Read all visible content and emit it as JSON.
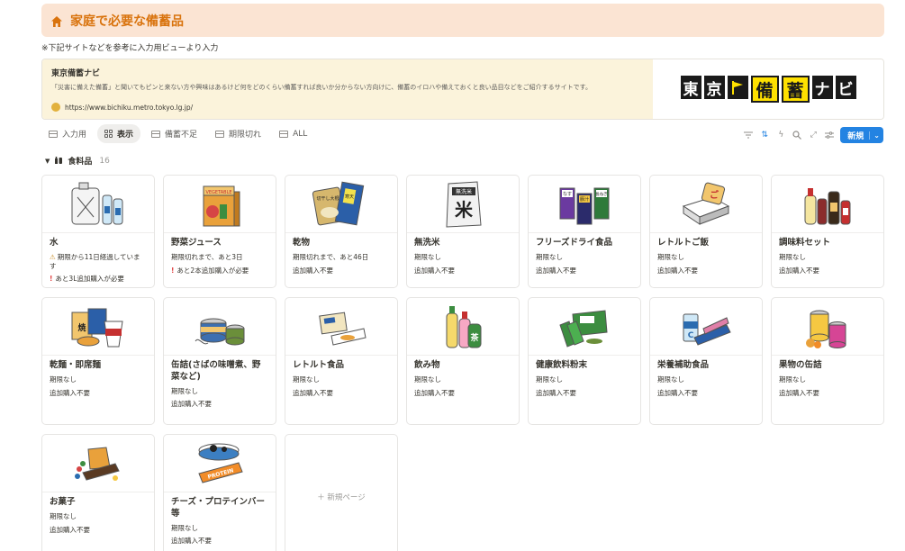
{
  "callout": {
    "title": "家庭で必要な備蓄品",
    "icon": "home-icon",
    "color": "#d9730d"
  },
  "note": "※下記サイトなどを参考に入力用ビューより入力",
  "bookmark": {
    "title": "東京備蓄ナビ",
    "description": "「災害に備えた備蓄」と聞いてもピンと来ない方や興味はあるけど何をどのくらい備蓄すれば良いか分からない方向けに、備蓄のイロハや備えておくと良い品目などをご紹介するサイトです。",
    "url": "https://www.bichiku.metro.tokyo.lg.jp/",
    "logo_chars": [
      "東",
      "京",
      "備",
      "蓄",
      "ナ",
      "ビ"
    ]
  },
  "tabs": [
    {
      "label": "入力用",
      "active": false
    },
    {
      "label": "表示",
      "active": true
    },
    {
      "label": "備蓄不足",
      "active": false
    },
    {
      "label": "期限切れ",
      "active": false
    },
    {
      "label": "ALL",
      "active": false
    }
  ],
  "toolbar": {
    "new_label": "新規",
    "accent": "#2383e2"
  },
  "group": {
    "name": "食料品",
    "count": "16"
  },
  "cards": [
    {
      "name": "水",
      "props": [
        "期限から11日経過しています",
        "あと3L追加購入が必要"
      ],
      "icon": "water-jug-bottles-icon"
    },
    {
      "name": "野菜ジュース",
      "props": [
        "期限切れまで、あと3日",
        "あと2本追加購入が必要"
      ],
      "icon": "vegetable-juice-icon"
    },
    {
      "name": "乾物",
      "props": [
        "期限切れまで、あと46日",
        "追加購入不要"
      ],
      "icon": "dried-food-icon"
    },
    {
      "name": "無洗米",
      "props": [
        "期限なし",
        "追加購入不要"
      ],
      "icon": "rice-bag-icon"
    },
    {
      "name": "フリーズドライ食品",
      "props": [
        "期限なし",
        "追加購入不要"
      ],
      "icon": "freeze-dried-food-icon"
    },
    {
      "name": "レトルトご飯",
      "props": [
        "期限なし",
        "追加購入不要"
      ],
      "icon": "retort-rice-icon"
    },
    {
      "name": "調味料セット",
      "props": [
        "期限なし",
        "追加購入不要"
      ],
      "icon": "seasoning-bottles-icon"
    },
    {
      "name": "乾麺・即席麺",
      "props": [
        "期限なし",
        "追加購入不要"
      ],
      "icon": "instant-noodles-icon"
    },
    {
      "name": "缶詰(さばの味噌煮、野菜など)",
      "props": [
        "期限なし",
        "追加購入不要"
      ],
      "icon": "canned-food-icon"
    },
    {
      "name": "レトルト食品",
      "props": [
        "期限なし",
        "追加購入不要"
      ],
      "icon": "retort-pouch-icon"
    },
    {
      "name": "飲み物",
      "props": [
        "期限なし",
        "追加購入不要"
      ],
      "icon": "drink-bottles-icon"
    },
    {
      "name": "健康飲料粉末",
      "props": [
        "期限なし",
        "追加購入不要"
      ],
      "icon": "health-powder-icon"
    },
    {
      "name": "栄養補助食品",
      "props": [
        "期限なし",
        "追加購入不要"
      ],
      "icon": "nutrition-bar-icon"
    },
    {
      "name": "果物の缶詰",
      "props": [
        "期限なし",
        "追加購入不要"
      ],
      "icon": "fruit-can-icon"
    },
    {
      "name": "お菓子",
      "props": [
        "期限なし",
        "追加購入不要"
      ],
      "icon": "snacks-icon"
    },
    {
      "name": "チーズ・プロテインバー等",
      "props": [
        "期限なし",
        "追加購入不要"
      ],
      "icon": "cheese-protein-bar-icon"
    }
  ],
  "new_page_label": "＋ 新規ページ",
  "image_labels": {
    "rice": "無洗米",
    "juice": "VEGETABLE",
    "dried": "切干し大根",
    "dried2": "寒天",
    "fd1": "なす",
    "fd2": "長ねぎ",
    "fd3": "豚汁",
    "retort_rice": "ご",
    "drink": "茶",
    "noodle": "焼",
    "protein": "PROTEIN"
  }
}
